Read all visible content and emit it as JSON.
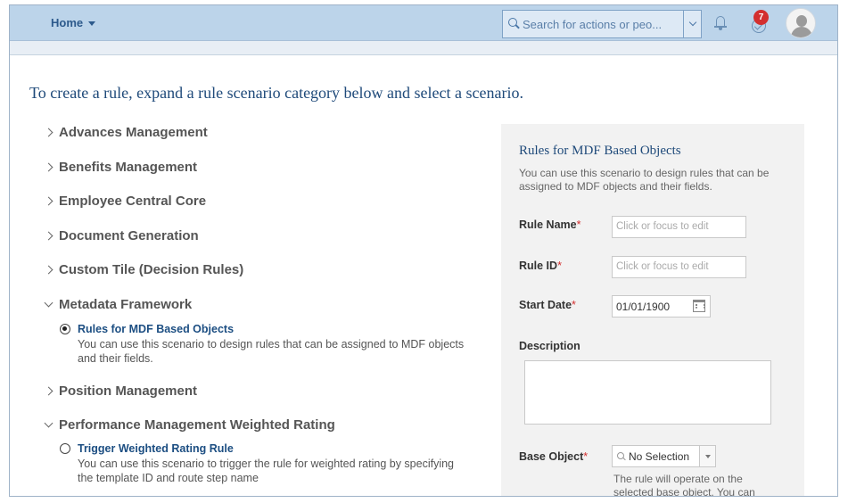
{
  "header": {
    "home_label": "Home",
    "search_placeholder": "Search for actions or peo...",
    "notification_count": "7"
  },
  "intro_text": "To create a rule, expand a rule scenario category below and select a scenario.",
  "categories": [
    {
      "label": "Advances Management",
      "expanded": false
    },
    {
      "label": "Benefits Management",
      "expanded": false
    },
    {
      "label": "Employee Central Core",
      "expanded": false
    },
    {
      "label": "Document Generation",
      "expanded": false
    },
    {
      "label": "Custom Tile (Decision Rules)",
      "expanded": false
    },
    {
      "label": "Metadata Framework",
      "expanded": true
    },
    {
      "label": "Position Management",
      "expanded": false
    },
    {
      "label": "Performance Management Weighted Rating",
      "expanded": true
    }
  ],
  "scenarios": [
    {
      "title": "Rules for MDF Based Objects",
      "desc": "You can use this scenario to design rules that can be assigned to MDF objects and their fields.",
      "selected": true
    },
    {
      "title": "Trigger Weighted Rating Rule",
      "desc": "You can use this scenario to trigger the rule for weighted rating by specifying the template ID and route step name",
      "selected": false
    }
  ],
  "panel": {
    "title": "Rules for MDF Based Objects",
    "desc": "You can use this scenario to design rules that can be assigned to MDF objects and their fields.",
    "rule_name_label": "Rule Name",
    "rule_name_placeholder": "Click or focus to edit",
    "rule_id_label": "Rule ID",
    "rule_id_placeholder": "Click or focus to edit",
    "start_date_label": "Start Date",
    "start_date_value": "01/01/1900",
    "description_label": "Description",
    "base_object_label": "Base Object",
    "base_object_value": "No Selection",
    "base_object_hint": "The rule will operate on the selected base object. You can",
    "required_marker": "*"
  },
  "colors": {
    "shell": "#bcd4ea",
    "link": "#1c4e82",
    "required": "#d32f2f",
    "badge": "#d32f2f"
  }
}
